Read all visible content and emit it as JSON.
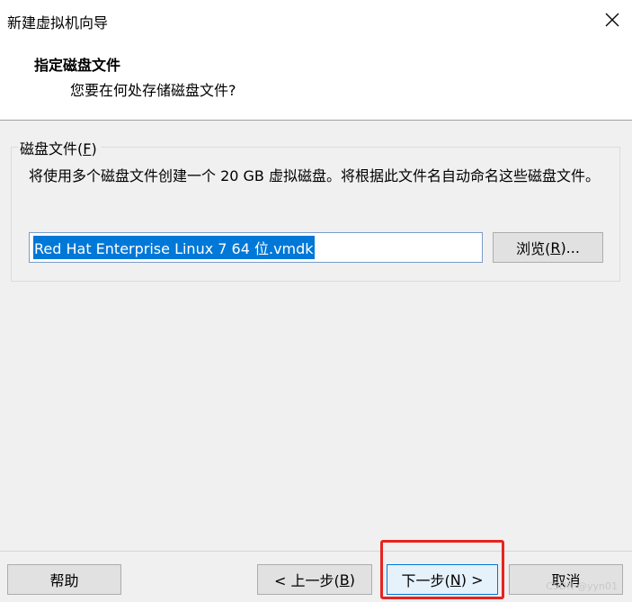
{
  "window": {
    "title": "新建虚拟机向导",
    "close_icon": "close-icon"
  },
  "header": {
    "title": "指定磁盘文件",
    "subtitle": "您要在何处存储磁盘文件?"
  },
  "disk_group": {
    "legend_prefix": "磁盘文件(",
    "legend_key": "F",
    "legend_suffix": ")",
    "description": "将使用多个磁盘文件创建一个 20 GB 虚拟磁盘。将根据此文件名自动命名这些磁盘文件。",
    "file_value": "Red Hat Enterprise Linux 7 64 位.vmdk",
    "browse_prefix": "浏览(",
    "browse_key": "R",
    "browse_suffix": ")..."
  },
  "footer": {
    "help_label": "帮助",
    "back_prefix": "< 上一步(",
    "back_key": "B",
    "back_suffix": ")",
    "next_prefix": "下一步(",
    "next_key": "N",
    "next_suffix": ") >",
    "cancel_label": "取消"
  },
  "watermark": "CSDN @yyn01",
  "colors": {
    "highlight": "#e8231f",
    "selection": "#0078d7"
  }
}
